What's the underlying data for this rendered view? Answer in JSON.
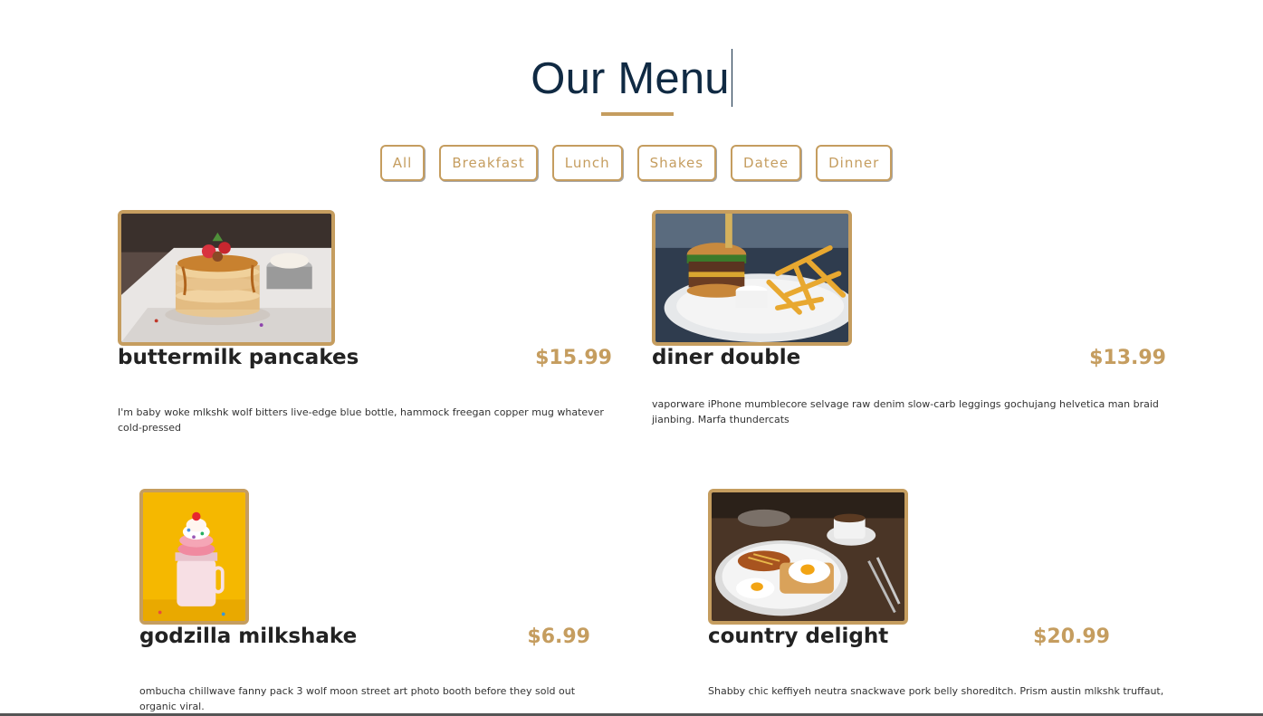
{
  "header": {
    "title": "Our Menu"
  },
  "filters": [
    "All",
    "Breakfast",
    "Lunch",
    "Shakes",
    "Datee",
    "Dinner"
  ],
  "colors": {
    "accent": "#c59d5f",
    "title": "#102a43",
    "text": "#222222"
  },
  "items": [
    {
      "name": "buttermilk pancakes",
      "price": "$15.99",
      "desc": "I'm baby woke mlkshk wolf bitters live-edge blue bottle, hammock freegan copper mug whatever cold-pressed",
      "image": "pancakes-photo"
    },
    {
      "name": "diner double",
      "price": "$13.99",
      "desc": "vaporware iPhone mumblecore selvage raw denim slow-carb leggings gochujang helvetica man braid jianbing. Marfa thundercats",
      "image": "burger-photo"
    },
    {
      "name": "godzilla milkshake",
      "price": "$6.99",
      "desc": "ombucha chillwave fanny pack 3 wolf moon street art photo booth before they sold out organic viral.",
      "image": "milkshake-photo"
    },
    {
      "name": "country delight",
      "price": "$20.99",
      "desc": "Shabby chic keffiyeh neutra snackwave pork belly shoreditch. Prism austin mlkshk truffaut,",
      "image": "breakfast-plate-photo"
    }
  ]
}
